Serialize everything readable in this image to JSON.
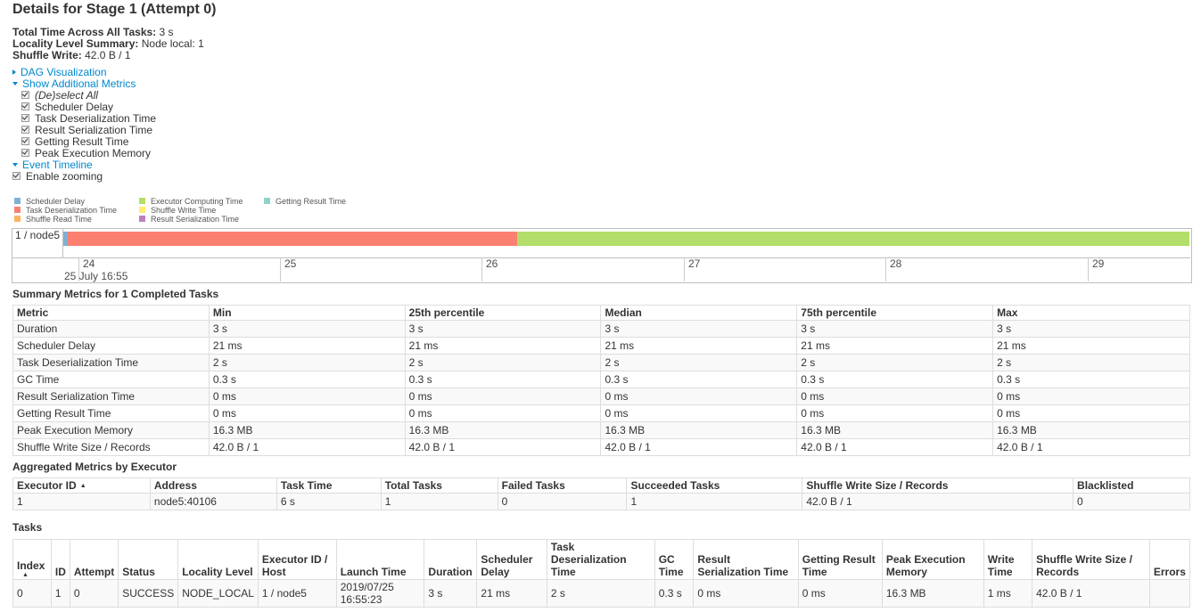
{
  "title": "Details for Stage 1 (Attempt 0)",
  "summary": [
    {
      "label": "Total Time Across All Tasks:",
      "value": "3 s"
    },
    {
      "label": "Locality Level Summary:",
      "value": "Node local: 1"
    },
    {
      "label": "Shuffle Write:",
      "value": "42.0 B / 1"
    }
  ],
  "dag_link": "DAG Visualization",
  "metrics_link": "Show Additional Metrics",
  "metrics_options": [
    "(De)select All",
    "Scheduler Delay",
    "Task Deserialization Time",
    "Result Serialization Time",
    "Getting Result Time",
    "Peak Execution Memory"
  ],
  "timeline_link": "Event Timeline",
  "zoom_label": "Enable zooming",
  "legend": [
    {
      "label": "Scheduler Delay",
      "color": "#80b1d3"
    },
    {
      "label": "Task Deserialization Time",
      "color": "#fb8072"
    },
    {
      "label": "Shuffle Read Time",
      "color": "#fdb462"
    },
    {
      "label": "Executor Computing Time",
      "color": "#b3de69"
    },
    {
      "label": "Shuffle Write Time",
      "color": "#ffed6f"
    },
    {
      "label": "Result Serialization Time",
      "color": "#bc80bd"
    },
    {
      "label": "Getting Result Time",
      "color": "#8dd3c7"
    }
  ],
  "timeline": {
    "row_label": "1 / node5",
    "ticks": [
      "24",
      "25",
      "26",
      "27",
      "28",
      "29"
    ],
    "date_label": "25 July 16:55"
  },
  "summary_metrics": {
    "heading": "Summary Metrics for 1 Completed Tasks",
    "headers": [
      "Metric",
      "Min",
      "25th percentile",
      "Median",
      "75th percentile",
      "Max"
    ],
    "rows": [
      [
        "Duration",
        "3 s",
        "3 s",
        "3 s",
        "3 s",
        "3 s"
      ],
      [
        "Scheduler Delay",
        "21 ms",
        "21 ms",
        "21 ms",
        "21 ms",
        "21 ms"
      ],
      [
        "Task Deserialization Time",
        "2 s",
        "2 s",
        "2 s",
        "2 s",
        "2 s"
      ],
      [
        "GC Time",
        "0.3 s",
        "0.3 s",
        "0.3 s",
        "0.3 s",
        "0.3 s"
      ],
      [
        "Result Serialization Time",
        "0 ms",
        "0 ms",
        "0 ms",
        "0 ms",
        "0 ms"
      ],
      [
        "Getting Result Time",
        "0 ms",
        "0 ms",
        "0 ms",
        "0 ms",
        "0 ms"
      ],
      [
        "Peak Execution Memory",
        "16.3 MB",
        "16.3 MB",
        "16.3 MB",
        "16.3 MB",
        "16.3 MB"
      ],
      [
        "Shuffle Write Size / Records",
        "42.0 B / 1",
        "42.0 B / 1",
        "42.0 B / 1",
        "42.0 B / 1",
        "42.0 B / 1"
      ]
    ]
  },
  "executors": {
    "heading": "Aggregated Metrics by Executor",
    "headers": [
      "Executor ID",
      "Address",
      "Task Time",
      "Total Tasks",
      "Failed Tasks",
      "Succeeded Tasks",
      "Shuffle Write Size / Records",
      "Blacklisted"
    ],
    "sort_arrow": "▲",
    "rows": [
      [
        "1",
        "node5:40106",
        "6 s",
        "1",
        "0",
        "1",
        "42.0 B / 1",
        "0"
      ]
    ]
  },
  "tasks": {
    "heading": "Tasks",
    "headers": [
      "Index",
      "ID",
      "Attempt",
      "Status",
      "Locality Level",
      "Executor ID / Host",
      "Launch Time",
      "Duration",
      "Scheduler Delay",
      "Task Deserialization Time",
      "GC Time",
      "Result Serialization Time",
      "Getting Result Time",
      "Peak Execution Memory",
      "Write Time",
      "Shuffle Write Size / Records",
      "Errors"
    ],
    "sort_arrow": "▲",
    "rows": [
      [
        "0",
        "1",
        "0",
        "SUCCESS",
        "NODE_LOCAL",
        "1 / node5",
        "2019/07/25 16:55:23",
        "3 s",
        "21 ms",
        "2 s",
        "0.3 s",
        "0 ms",
        "0 ms",
        "16.3 MB",
        "1 ms",
        "42.0 B / 1",
        ""
      ]
    ]
  }
}
